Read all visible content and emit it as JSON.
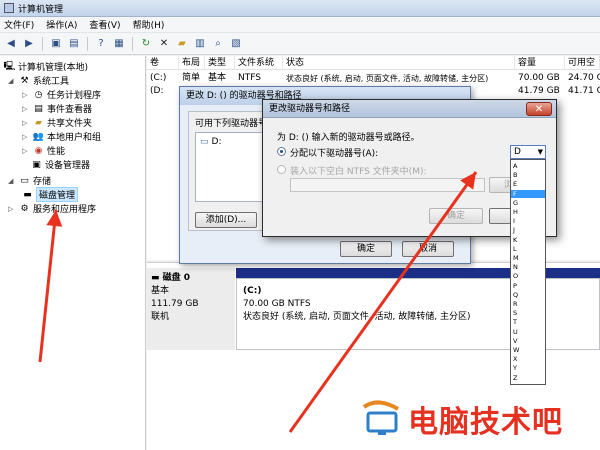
{
  "window": {
    "title": "计算机管理"
  },
  "menu": [
    "文件(F)",
    "操作(A)",
    "查看(V)",
    "帮助(H)"
  ],
  "tree": {
    "root": "计算机管理(本地)",
    "system_tools": "系统工具",
    "items": [
      "任务计划程序",
      "事件查看器",
      "共享文件夹",
      "本地用户和组",
      "性能",
      "设备管理器"
    ],
    "storage": "存储",
    "disk_mgmt": "磁盘管理",
    "services": "服务和应用程序"
  },
  "list": {
    "headers": [
      "卷",
      "布局",
      "类型",
      "文件系统",
      "状态",
      "容量",
      "可用空"
    ],
    "row1": [
      "(C:)",
      "简单",
      "基本",
      "NTFS",
      "状态良好 (系统, 启动, 页面文件, 活动, 故障转储, 主分区)",
      "70.00 GB",
      "24.70 G"
    ],
    "row2": [
      "(D:",
      "41.79 GB",
      "41.71 G"
    ]
  },
  "disk": {
    "name": "磁盘 0",
    "type": "基本",
    "size": "111.79 GB",
    "status": "联机",
    "vol_label": "(C:)",
    "vol_size": "70.00 GB NTFS",
    "vol_status": "状态良好 (系统, 启动, 页面文件, 活动, 故障转储, 主分区)"
  },
  "dialog_outer": {
    "title": "更改 D: () 的驱动器号和路径",
    "group_label": "可用下列驱动器号和路径",
    "list_item": "D:",
    "add_btn": "添加(D)...",
    "ok_btn": "确定",
    "cancel_btn": "取消"
  },
  "dialog_inner": {
    "title": "更改驱动器号和路径",
    "prompt": "为 D: () 输入新的驱动器号或路径。",
    "option1": "分配以下驱动器号(A):",
    "option2": "装入以下空白 NTFS 文件夹中(M):",
    "browse_btn": "浏览",
    "ok_btn": "确定",
    "cancel_btn": "取",
    "selected_letter": "D"
  },
  "dropdown_letters": [
    "A",
    "B",
    "E",
    "F",
    "G",
    "H",
    "I",
    "J",
    "K",
    "L",
    "M",
    "N",
    "O",
    "P",
    "Q",
    "R",
    "S",
    "T",
    "U",
    "V",
    "W",
    "X",
    "Y",
    "Z"
  ],
  "dropdown_selected_index": 3,
  "watermark": {
    "text": "电脑技术吧"
  },
  "colors": {
    "arrow": "#e8321e",
    "title_bar": "#c2d5ec",
    "volume_bar": "#1c2f88",
    "highlight": "#3399ff"
  }
}
